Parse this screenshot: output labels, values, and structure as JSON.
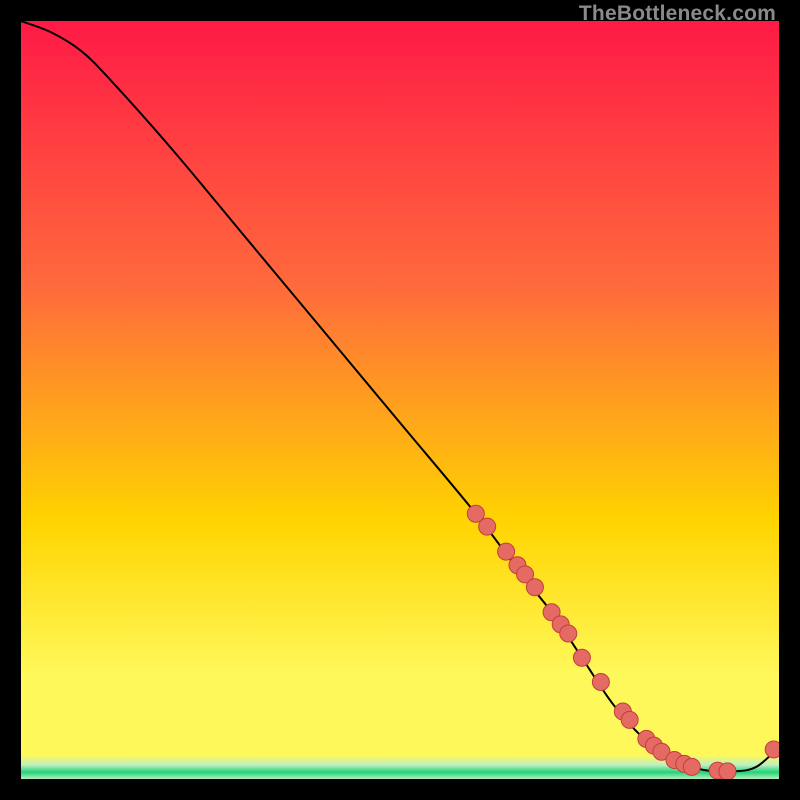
{
  "watermark": {
    "text": "TheBottleneck.com"
  },
  "colors": {
    "marker_fill": "#e46a63",
    "marker_stroke": "#c23f3c",
    "curve": "#000000",
    "gradient_top": "#ff1a46",
    "gradient_mid_upper": "#ff6a3c",
    "gradient_mid": "#ffd400",
    "gradient_mid_lower": "#fff85a",
    "green_top": "#bff0c0",
    "green_core": "#22d37a",
    "black": "#000000"
  },
  "chart_data": {
    "type": "line",
    "title": "",
    "xlabel": "",
    "ylabel": "",
    "xlim": [
      0,
      100
    ],
    "ylim": [
      0,
      100
    ],
    "grid": false,
    "legend": false,
    "series": [
      {
        "name": "bottleneck-curve",
        "x": [
          0,
          4,
          8,
          12,
          20,
          30,
          40,
          50,
          60,
          66,
          70,
          74,
          78,
          82,
          86,
          90,
          94,
          97,
          100
        ],
        "y": [
          100,
          98.5,
          96,
          92,
          83,
          71,
          59,
          47,
          35,
          27,
          22,
          16,
          10,
          5.5,
          2.5,
          1.2,
          1.0,
          1.6,
          4.2
        ]
      }
    ],
    "markers": {
      "name": "highlighted-points",
      "x": [
        60,
        61.5,
        64,
        65.5,
        66.5,
        67.8,
        70,
        71.2,
        72.2,
        74,
        76.5,
        79.4,
        80.3,
        82.5,
        83.5,
        84.5,
        86.2,
        87.5,
        88.5,
        91.9,
        93.2,
        99.3
      ],
      "y": [
        35,
        33.3,
        30,
        28.2,
        27,
        25.3,
        22,
        20.4,
        19.2,
        16,
        12.8,
        8.9,
        7.8,
        5.3,
        4.4,
        3.6,
        2.5,
        2.0,
        1.6,
        1.1,
        1.0,
        3.9
      ]
    },
    "green_band": {
      "y_center": 1.0,
      "y_half_width": 2.2
    }
  }
}
